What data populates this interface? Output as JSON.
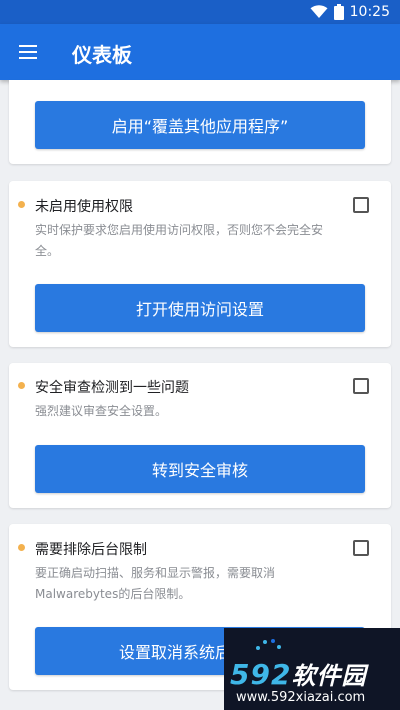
{
  "status_bar": {
    "time": "10:25",
    "wifi_icon": "wifi-icon",
    "battery_icon": "battery-icon"
  },
  "app_bar": {
    "menu_icon": "menu-icon",
    "title": "仪表板"
  },
  "cards": [
    {
      "button_label": "启用“覆盖其他应用程序”"
    },
    {
      "title": "未启用使用权限",
      "description": "实时保护要求您启用使用访问权限，否则您不会完全安全。",
      "button_label": "打开使用访问设置"
    },
    {
      "title": "安全审查检测到一些问题",
      "description": "强烈建议审查安全设置。",
      "button_label": "转到安全审核"
    },
    {
      "title": "需要排除后台限制",
      "description": "要正确启动扫描、服务和显示警报，需要取消Malwarebytes的后台限制。",
      "button_label": "设置取消系统后"
    }
  ],
  "watermark": {
    "logo_num": "592",
    "logo_text": "软件园",
    "url": "www.592xiazai.com"
  },
  "colors": {
    "primary": "#1e6fe0",
    "button": "#2979e0",
    "warning_dot": "#f3b14e"
  }
}
